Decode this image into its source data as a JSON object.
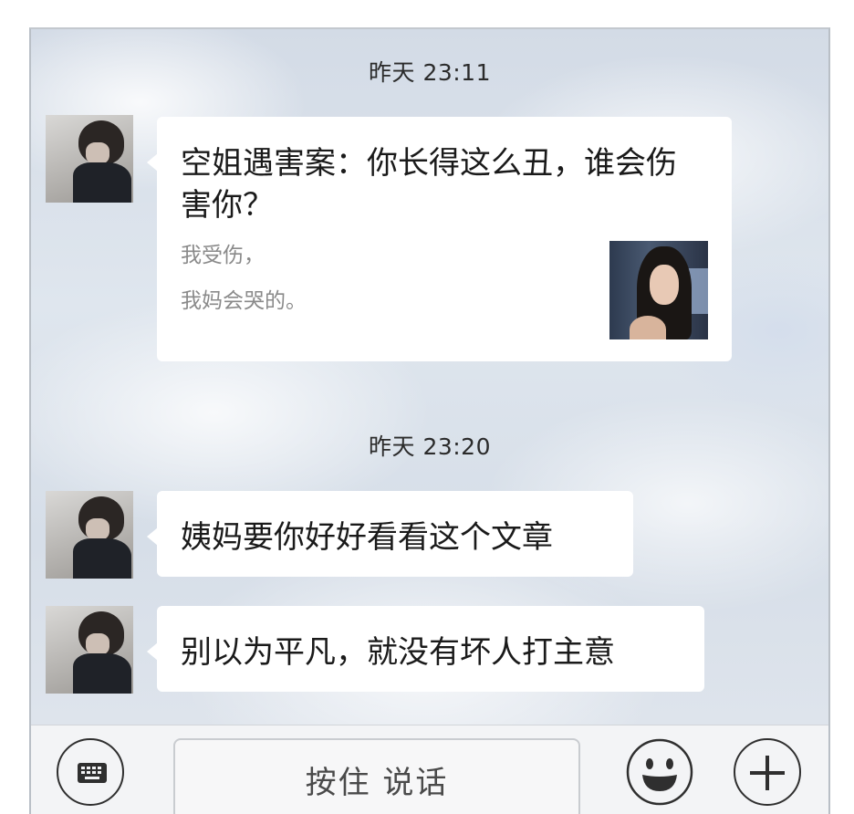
{
  "chat": {
    "timestamp_1": "昨天 23:11",
    "timestamp_2": "昨天 23:20",
    "article_card": {
      "title": "空姐遇害案：你长得这么丑，谁会伤害你？",
      "desc_line1": "我受伤，",
      "desc_line2": "我妈会哭的。"
    },
    "message_2": "姨妈要你好好看看这个文章",
    "message_3": "别以为平凡，就没有坏人打主意"
  },
  "input_bar": {
    "hold_to_talk_label": "按住 说话",
    "keyboard_icon": "keyboard-icon",
    "emoji_icon": "smiley-icon",
    "more_icon": "plus-icon"
  },
  "colors": {
    "bubble": "#ffffff",
    "text": "#1a1a1a",
    "subtext": "#8a8a8a",
    "bar": "#f3f4f6"
  }
}
